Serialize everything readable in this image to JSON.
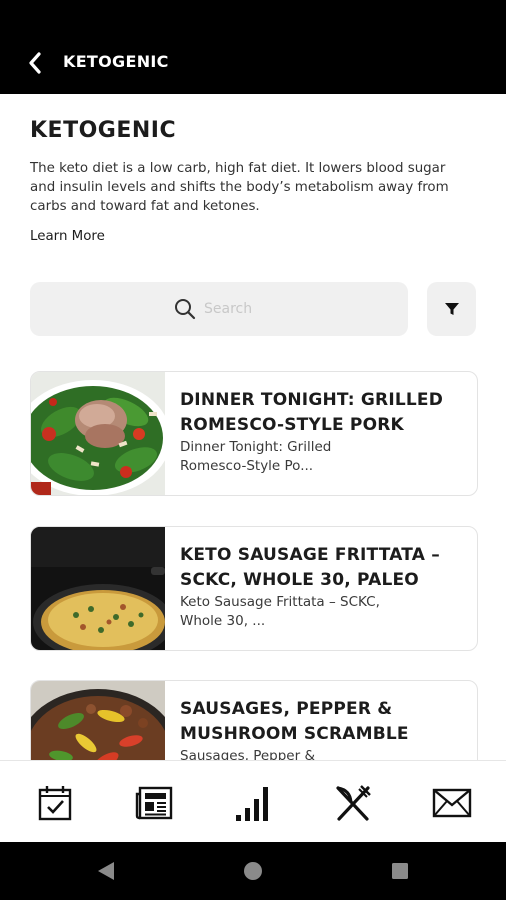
{
  "header": {
    "title": "KETOGENIC",
    "back_icon": "chevron-left-icon"
  },
  "intro": {
    "title": "KETOGENIC",
    "description": "The keto diet is a low carb, high fat diet. It lowers blood sugar and insulin levels and shifts the body’s metabolism away from carbs and toward fat and ketones.",
    "learn_more": "Learn More"
  },
  "search": {
    "placeholder": "Search",
    "icon": "search-icon",
    "filter_icon": "filter-icon"
  },
  "recipes": [
    {
      "title": "DINNER TONIGHT: GRILLED ROMESCO-STYLE PORK",
      "subtitle": "Dinner Tonight: Grilled Romesco-Style Po...",
      "image": "pork-salad-photo"
    },
    {
      "title": "KETO SAUSAGE FRITTATA – SCKC, WHOLE 30, PALEO",
      "subtitle": "Keto Sausage Frittata – SCKC, Whole 30, ...",
      "image": "frittata-pan-photo"
    },
    {
      "title": "SAUSAGES, PEPPER & MUSHROOM SCRAMBLE",
      "subtitle": "Sausages, Pepper &",
      "image": "sausage-pepper-skillet-photo"
    }
  ],
  "bottom_nav": [
    {
      "icon": "calendar-check-icon"
    },
    {
      "icon": "newspaper-icon"
    },
    {
      "icon": "bar-chart-icon"
    },
    {
      "icon": "fork-knife-icon"
    },
    {
      "icon": "envelope-icon"
    }
  ],
  "system_nav": [
    {
      "icon": "back-triangle-icon"
    },
    {
      "icon": "home-circle-icon"
    },
    {
      "icon": "recents-square-icon"
    }
  ],
  "colors": {
    "header_bg": "#000000",
    "text": "#1c1c1c",
    "search_bg": "#f0f0f0",
    "card_border": "#e3e3e3"
  }
}
